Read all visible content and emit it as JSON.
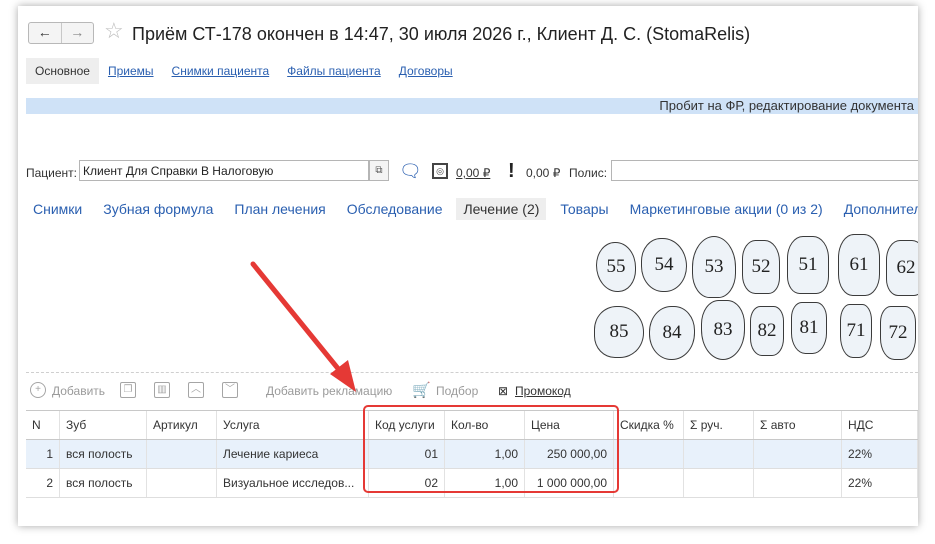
{
  "window": {
    "title": "Приём СТ-178 окончен в 14:47, 30 июля 2026 г., Клиент Д. С. (StomaRelis)",
    "back_label": "←",
    "forward_label": "→"
  },
  "main_tabs": [
    {
      "label": "Основное",
      "active": true
    },
    {
      "label": "Приемы"
    },
    {
      "label": "Снимки пациента"
    },
    {
      "label": "Файлы пациента"
    },
    {
      "label": "Договоры"
    }
  ],
  "status_bar": {
    "text": "Пробит на ФР, редактирование документа"
  },
  "patient": {
    "label": "Пациент:",
    "value": "Клиент Для Справки В Налоговую",
    "balance_link": "0,00 ₽",
    "debt_amount": "0,00 ₽",
    "polis_label": "Полис:",
    "polis_value": ""
  },
  "sub_tabs": [
    {
      "label": "Снимки"
    },
    {
      "label": "Зубная формула"
    },
    {
      "label": "План лечения"
    },
    {
      "label": "Обследование"
    },
    {
      "label": "Лечение (2)",
      "active": true
    },
    {
      "label": "Товары"
    },
    {
      "label": "Маркетинговые акции (0 из 2)"
    },
    {
      "label": "Дополнительно"
    }
  ],
  "teeth": {
    "upper": [
      "55",
      "54",
      "53",
      "52",
      "51",
      "61",
      "62"
    ],
    "lower": [
      "85",
      "84",
      "83",
      "82",
      "81",
      "71",
      "72"
    ]
  },
  "toolbar": {
    "add": "Добавить",
    "add_claim": "Добавить рекламацию",
    "pick": "Подбор",
    "promo": "Промокод"
  },
  "table": {
    "columns": [
      "N",
      "Зуб",
      "Артикул",
      "Услуга",
      "Код услуги",
      "Кол-во",
      "Цена",
      "Скидка %",
      "Σ руч.",
      "Σ авто",
      "НДС"
    ],
    "rows": [
      {
        "n": "1",
        "tooth": "вся полость",
        "article": "",
        "service": "Лечение кариеса",
        "code": "01",
        "qty": "1,00",
        "price": "250 000,00",
        "discount": "",
        "sum_manual": "",
        "sum_auto": "",
        "vat": "22%"
      },
      {
        "n": "2",
        "tooth": "вся полость",
        "article": "",
        "service": "Визуальное исследов...",
        "code": "02",
        "qty": "1,00",
        "price": "1 000 000,00",
        "discount": "",
        "sum_manual": "",
        "sum_auto": "",
        "vat": "22%"
      }
    ]
  },
  "colors": {
    "link": "#2a5fb0",
    "status_bar_bg": "#cfe2f7",
    "selected_row_bg": "#e8f1fb",
    "highlight_red": "#e53935"
  }
}
